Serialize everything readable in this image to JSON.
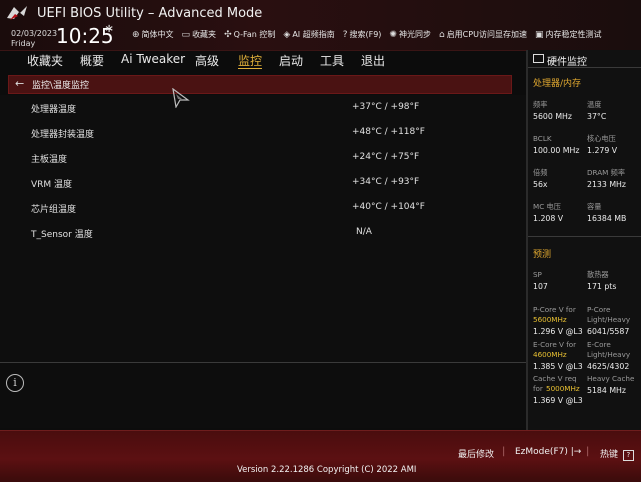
{
  "header": {
    "title": "UEFI BIOS Utility – Advanced Mode",
    "date": "02/03/2023",
    "day": "Friday",
    "time": "10:25",
    "tools": [
      {
        "icon": "globe-icon",
        "label": "简体中文"
      },
      {
        "icon": "bookmark-icon",
        "label": "收藏夹"
      },
      {
        "icon": "fan-icon",
        "label": "Q-Fan 控制"
      },
      {
        "icon": "ai-icon",
        "label": "AI 超频指南"
      },
      {
        "icon": "help-icon",
        "label": "搜索(F9)"
      },
      {
        "icon": "light-icon",
        "label": "神光同步"
      },
      {
        "icon": "cpu-icon",
        "label": "启用CPU访问显存加速"
      },
      {
        "icon": "memory-icon",
        "label": "内存稳定性测试"
      }
    ]
  },
  "nav": {
    "tabs": [
      "收藏夹",
      "概要",
      "Ai Tweaker",
      "高级",
      "监控",
      "启动",
      "工具",
      "退出"
    ],
    "active": "监控"
  },
  "breadcrumb": "监控\\温度监控",
  "rows": [
    {
      "label": "处理器温度",
      "value": "+37°C / +98°F"
    },
    {
      "label": "处理器封装温度",
      "value": "+48°C / +118°F"
    },
    {
      "label": "主板温度",
      "value": "+24°C / +75°F"
    },
    {
      "label": "VRM 温度",
      "value": "+34°C / +93°F"
    },
    {
      "label": "芯片组温度",
      "value": "+40°C / +104°F"
    },
    {
      "label": "T_Sensor 温度",
      "value": "N/A"
    }
  ],
  "sidebar": {
    "title": "硬件监控",
    "section1": "处理器/内存",
    "freq_label": "频率",
    "freq_value": "5600 MHz",
    "temp_label": "温度",
    "temp_value": "37°C",
    "bclk_label": "BCLK",
    "bclk_value": "100.00 MHz",
    "vcore_label": "核心电压",
    "vcore_value": "1.279 V",
    "ratio_label": "倍频",
    "ratio_value": "56x",
    "dram_label": "DRAM 频率",
    "dram_value": "2133 MHz",
    "mc_label": "MC 电压",
    "mc_value": "1.208 V",
    "cap_label": "容量",
    "cap_value": "16384 MB",
    "section2": "预测",
    "sp_label": "SP",
    "sp_value": "107",
    "cooler_label": "散热器",
    "cooler_value": "171 pts",
    "pcore_label1": "P-Core V for",
    "pcore_freq": "5600MHz",
    "pcore_value": "1.296 V @L3",
    "pcore_lh_label1": "P-Core",
    "pcore_lh_label2": "Light/Heavy",
    "pcore_lh_value": "6041/5587",
    "ecore_label1": "E-Core V for",
    "ecore_freq": "4600MHz",
    "ecore_value": "1.385 V @L3",
    "ecore_lh_label1": "E-Core",
    "ecore_lh_label2": "Light/Heavy",
    "ecore_lh_value": "4625/4302",
    "cache_label1": "Cache V req",
    "cache_label2": "for",
    "cache_freq": "5000MHz",
    "cache_value": "1.369 V @L3",
    "cache_heavy_label": "Heavy Cache",
    "cache_heavy_value": "5184 MHz"
  },
  "footer": {
    "last_modified": "最后修改",
    "ezmode": "EzMode(F7)",
    "hotkeys": "热键",
    "hotkey_symbol": "?",
    "version": "Version 2.22.1286 Copyright (C) 2022 AMI"
  },
  "colors": {
    "accent": "#e0b03a",
    "brand_red": "#5c1012"
  }
}
